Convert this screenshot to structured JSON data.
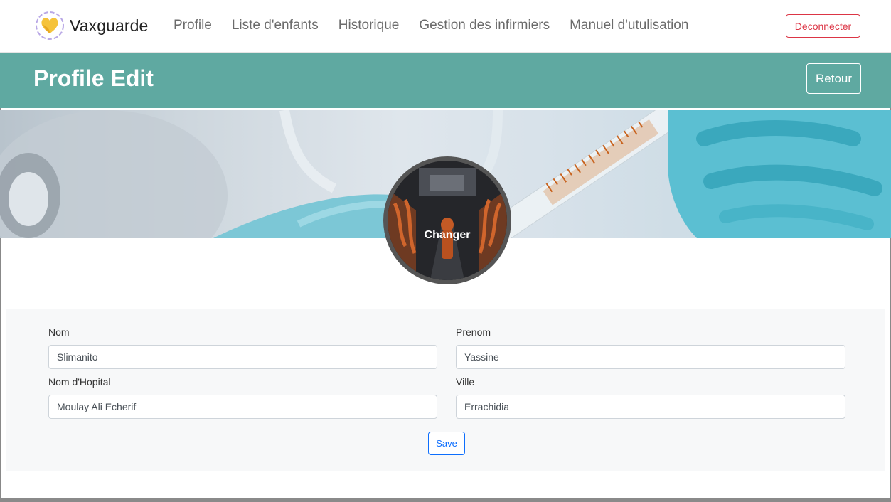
{
  "navbar": {
    "brand": "Vaxguarde",
    "logo_icon": "heart-logo-icon",
    "links": [
      "Profile",
      "Liste d'enfants",
      "Historique",
      "Gestion des infirmiers",
      "Manuel d'utulisation"
    ],
    "logout_label": "Deconnecter"
  },
  "header": {
    "title": "Profile Edit",
    "back_label": "Retour"
  },
  "avatar": {
    "change_label": "Changer"
  },
  "form": {
    "nom_label": "Nom",
    "nom_value": "Slimanito",
    "prenom_label": "Prenom",
    "prenom_value": "Yassine",
    "hopital_label": "Nom d'Hopital",
    "hopital_value": "Moulay Ali Echerif",
    "ville_label": "Ville",
    "ville_value": "Errachidia",
    "save_label": "Save"
  },
  "colors": {
    "accent": "#5fa9a1",
    "danger": "#dc3545",
    "primary": "#0d6efd"
  }
}
